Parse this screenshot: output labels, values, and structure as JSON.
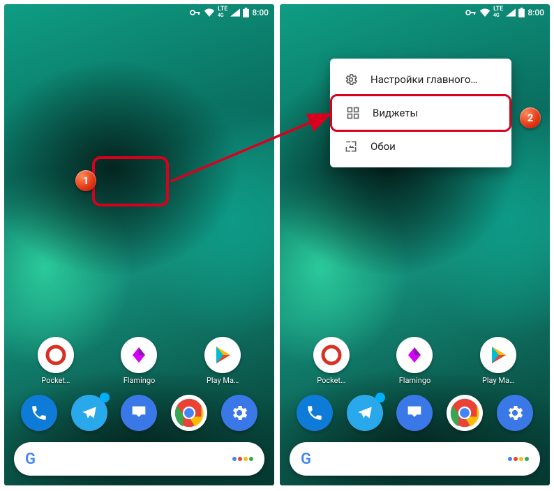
{
  "status": {
    "lte_top": "LTE",
    "lte_bot": "4G",
    "time": "8:00"
  },
  "apps_row1": [
    {
      "name": "Pocket…",
      "bg": "#fff",
      "letter": "◉",
      "fg": "#d93025"
    },
    {
      "name": "Flamingo",
      "bg": "#fff",
      "letter": "◆",
      "fg": "#d500f9"
    },
    {
      "name": "Play Ma…",
      "bg": "#fff",
      "letter": "▶",
      "fg": "#34a853"
    }
  ],
  "dock": [
    {
      "name": "Phone",
      "bg": "#0f7bd8"
    },
    {
      "name": "Telegram",
      "bg": "#29a9eb",
      "badge": true
    },
    {
      "name": "Inbox",
      "bg": "#3b78e7"
    },
    {
      "name": "Chrome",
      "bg": "#fff"
    },
    {
      "name": "Settings",
      "bg": "#3b78e7"
    }
  ],
  "ctx": {
    "settings": "Настройки главного…",
    "widgets": "Виджеты",
    "wallpaper": "Обои"
  },
  "markers": {
    "one": "1",
    "two": "2"
  }
}
